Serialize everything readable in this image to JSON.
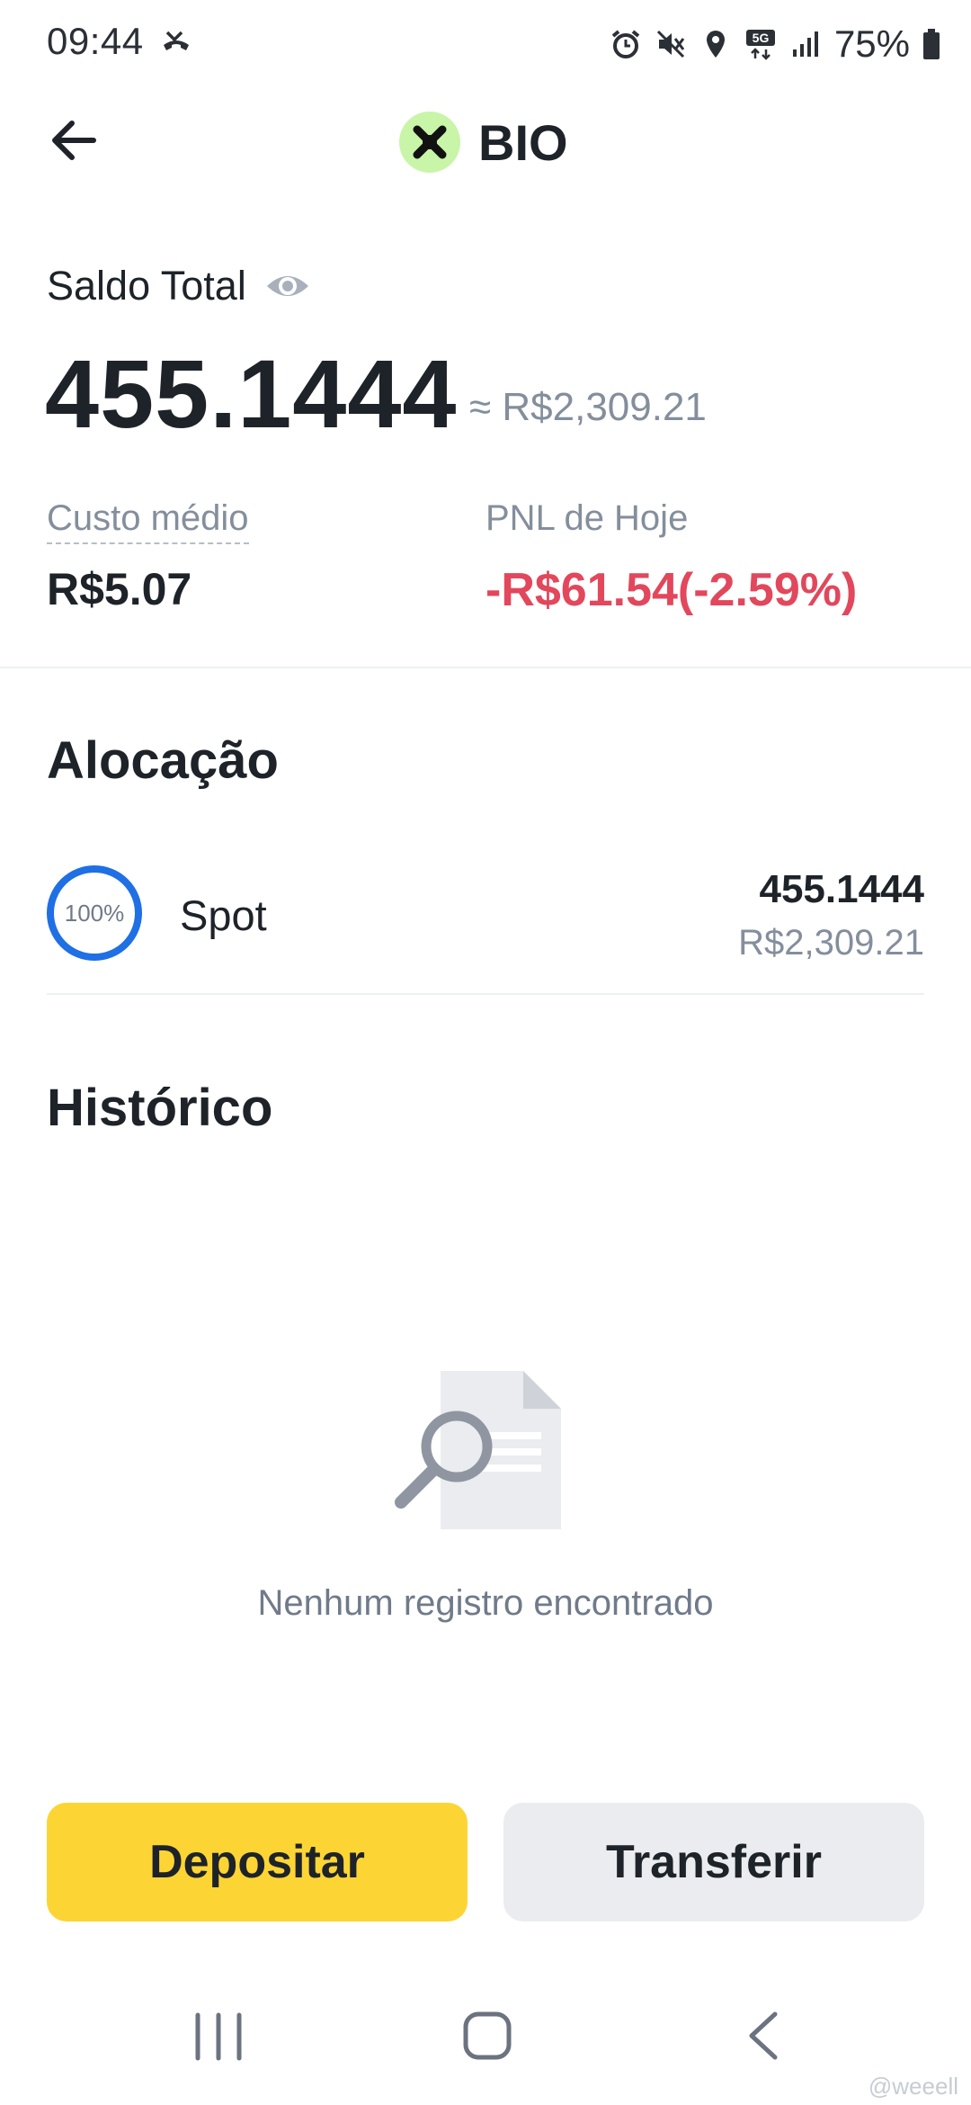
{
  "status_bar": {
    "time": "09:44",
    "battery": "75%",
    "icons": [
      "missed-call-icon",
      "alarm-icon",
      "mute-icon",
      "location-icon",
      "5g-icon",
      "signal-icon",
      "battery-icon"
    ]
  },
  "header": {
    "back_icon": "arrow-left-icon",
    "coin_symbol": "BIO",
    "coin_color": "#c8f5a8"
  },
  "balance": {
    "label": "Saldo Total",
    "amount": "455.1444",
    "fiat": "≈ R$2,309.21"
  },
  "stats": {
    "avg_cost_label": "Custo médio",
    "avg_cost_value": "R$5.07",
    "pnl_label": "PNL de Hoje",
    "pnl_value": "-R$61.54(-2.59%)",
    "pnl_color": "#e2475c"
  },
  "allocation": {
    "title": "Alocação",
    "items": [
      {
        "percent_label": "100%",
        "percent": 100,
        "name": "Spot",
        "amount": "455.1444",
        "fiat": "R$2,309.21",
        "ring_color": "#1f6fe5"
      }
    ]
  },
  "history": {
    "title": "Histórico",
    "empty_text": "Nenhum registro encontrado"
  },
  "actions": {
    "deposit": "Depositar",
    "transfer": "Transferir",
    "deposit_color": "#fcd535"
  },
  "watermark": "@weeell"
}
